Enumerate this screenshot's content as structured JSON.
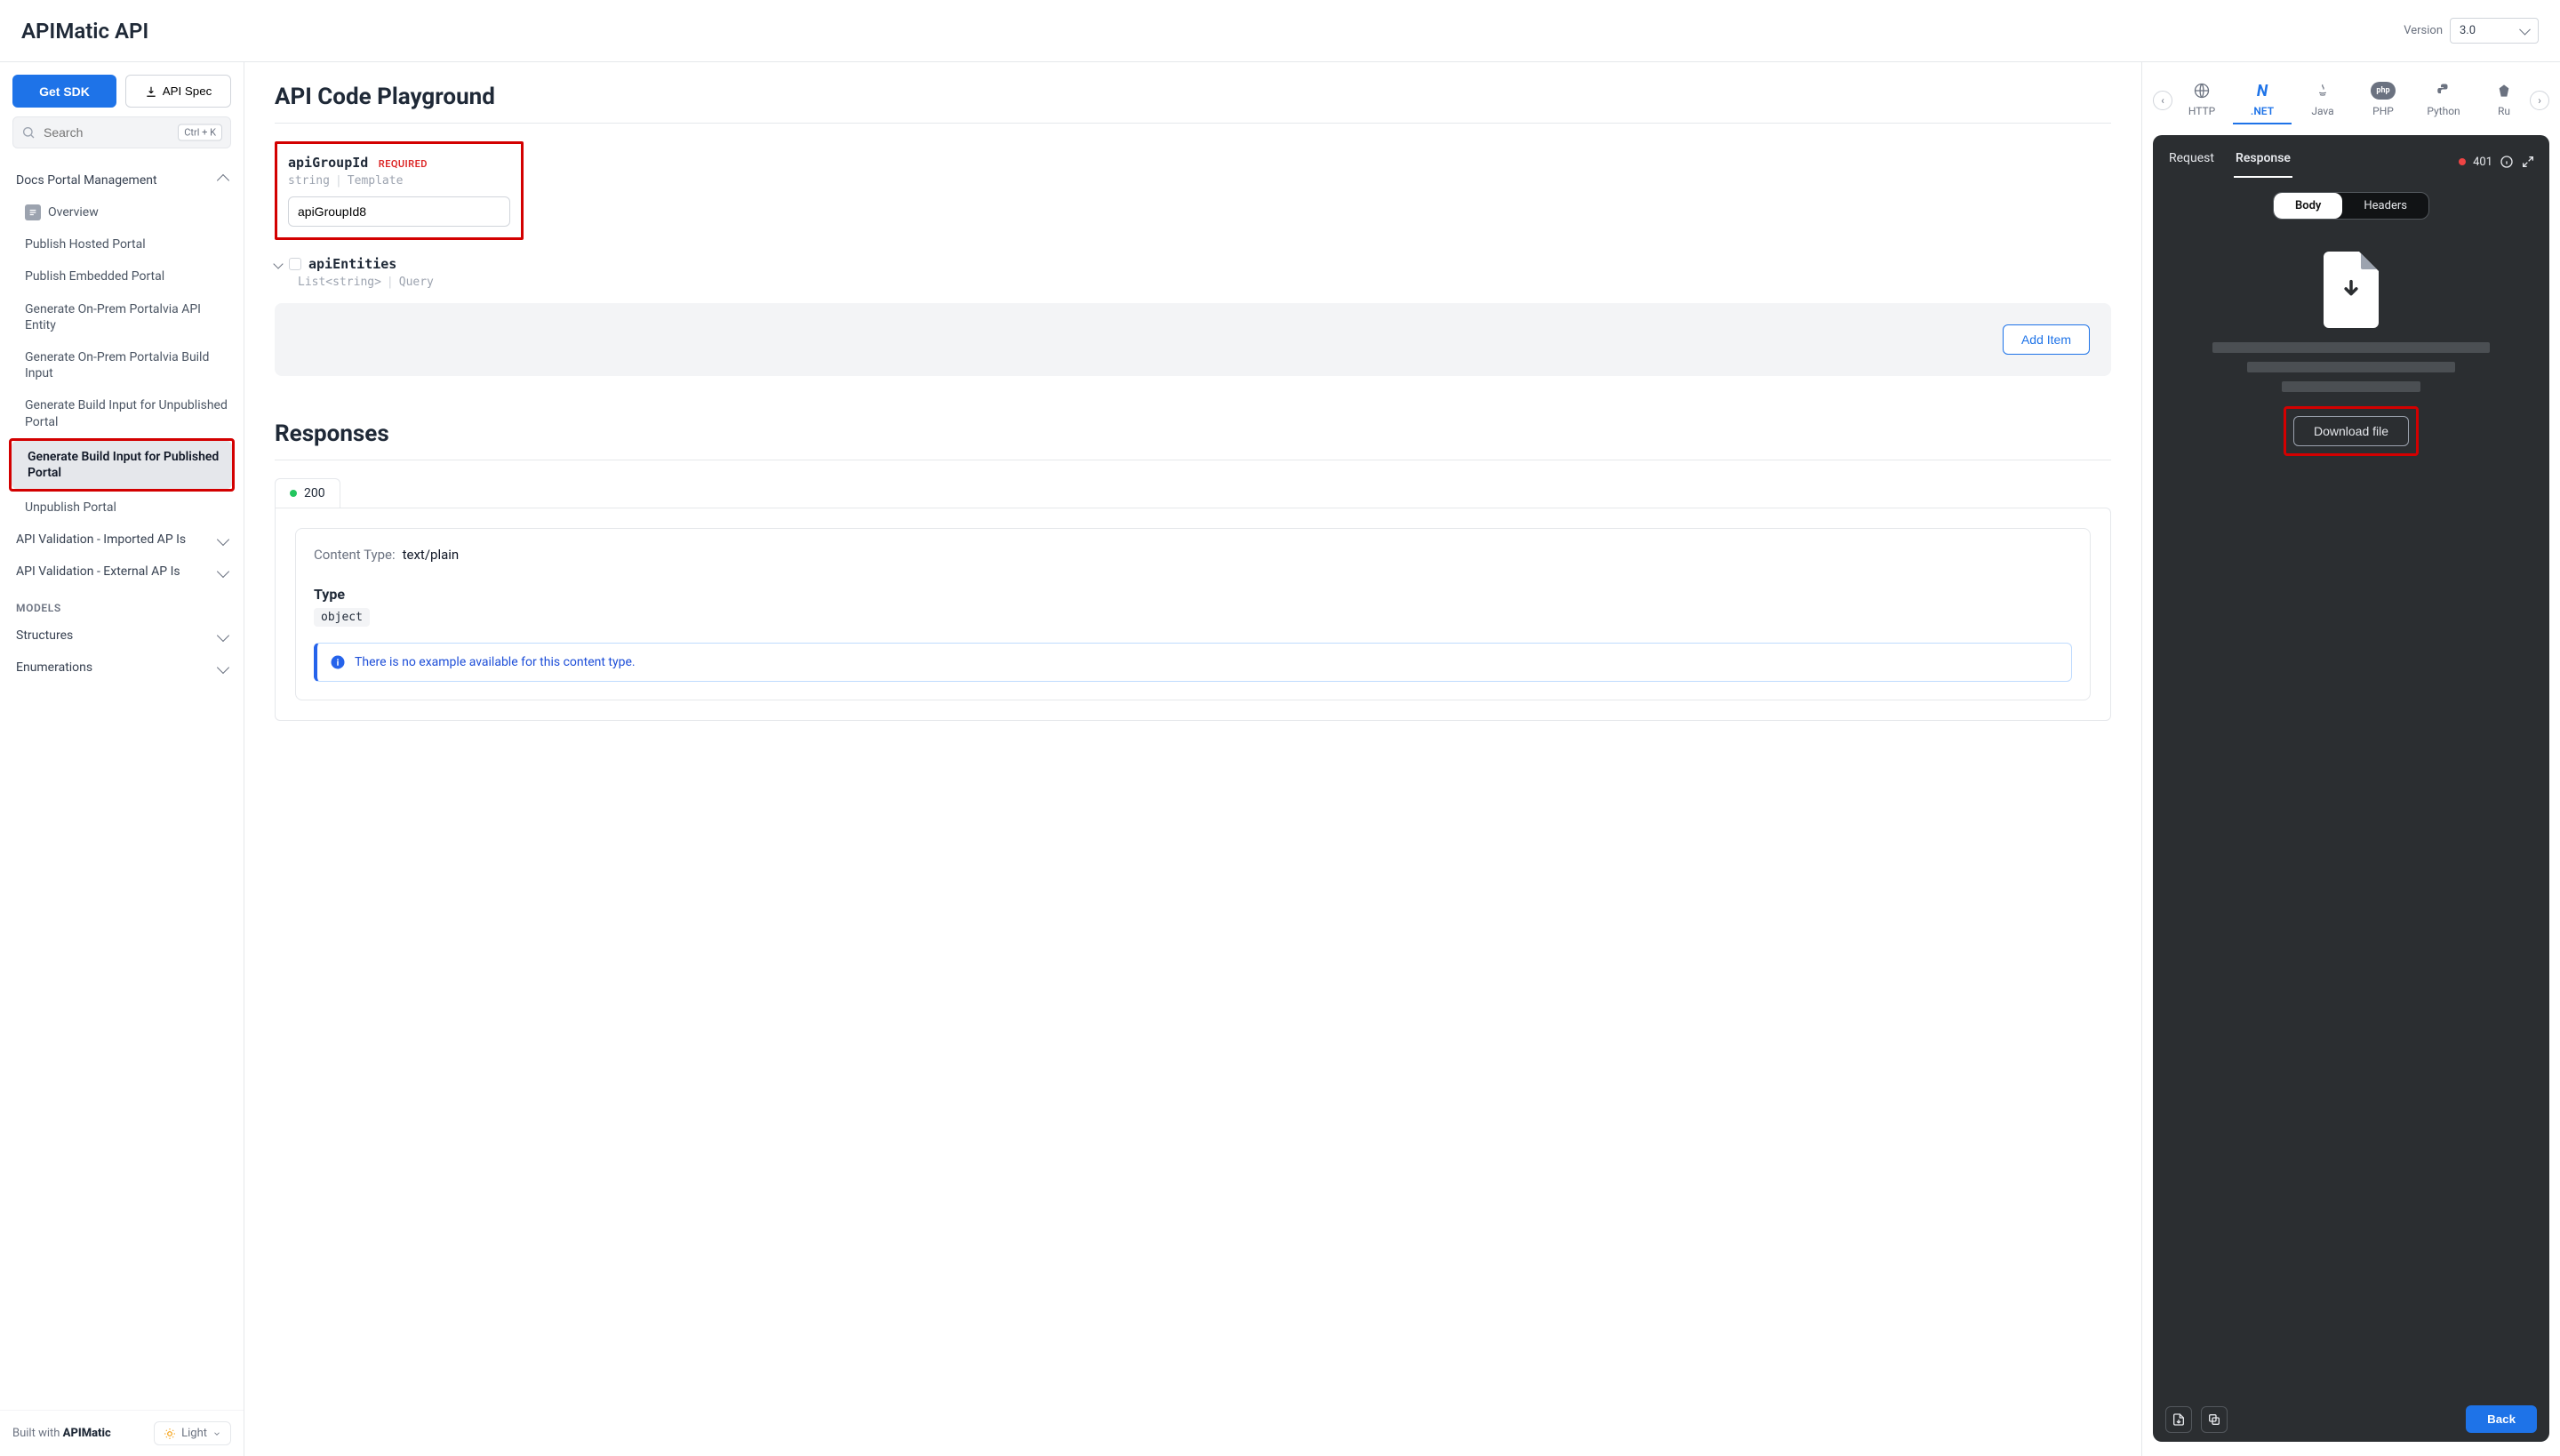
{
  "header": {
    "title": "APIMatic API",
    "version_label": "Version",
    "version_value": "3.0"
  },
  "sidebar": {
    "get_sdk": "Get SDK",
    "api_spec": "API Spec",
    "search_placeholder": "Search",
    "search_shortcut": "Ctrl + K",
    "group_expanded": "Docs Portal Management",
    "items": [
      "Overview",
      "Publish Hosted Portal",
      "Publish Embedded Portal",
      "Generate On-Prem Portalvia API Entity",
      "Generate On-Prem Portalvia Build Input",
      "Generate Build Input for Unpublished Portal",
      "Generate Build Input for Published Portal",
      "Unpublish Portal"
    ],
    "collapsed_groups": [
      "API Validation - Imported AP Is",
      "API Validation - External AP Is"
    ],
    "models_label": "MODELS",
    "models_groups": [
      "Structures",
      "Enumerations"
    ],
    "footer_built": "Built with",
    "footer_brand": "APIMatic",
    "footer_theme": "Light"
  },
  "main": {
    "playground_title": "API Code Playground",
    "param_name": "apiGroupId",
    "required": "REQUIRED",
    "param_type": "string",
    "param_loc": "Template",
    "param_value": "apiGroupId8",
    "entities_name": "apiEntities",
    "entities_type": "List<string>",
    "entities_loc": "Query",
    "add_item": "Add Item",
    "responses_title": "Responses",
    "status_200": "200",
    "content_type_label": "Content Type:",
    "content_type_value": "text/plain",
    "type_label": "Type",
    "type_value": "object",
    "info_msg": "There is no example available for this content type."
  },
  "right": {
    "languages": [
      "HTTP",
      ".NET",
      "Java",
      "PHP",
      "Python",
      "Ru"
    ],
    "active_language_index": 1,
    "tabs": {
      "request": "Request",
      "response": "Response"
    },
    "status_code": "401",
    "body_headers": {
      "body": "Body",
      "headers": "Headers"
    },
    "download_file": "Download file",
    "back": "Back"
  }
}
